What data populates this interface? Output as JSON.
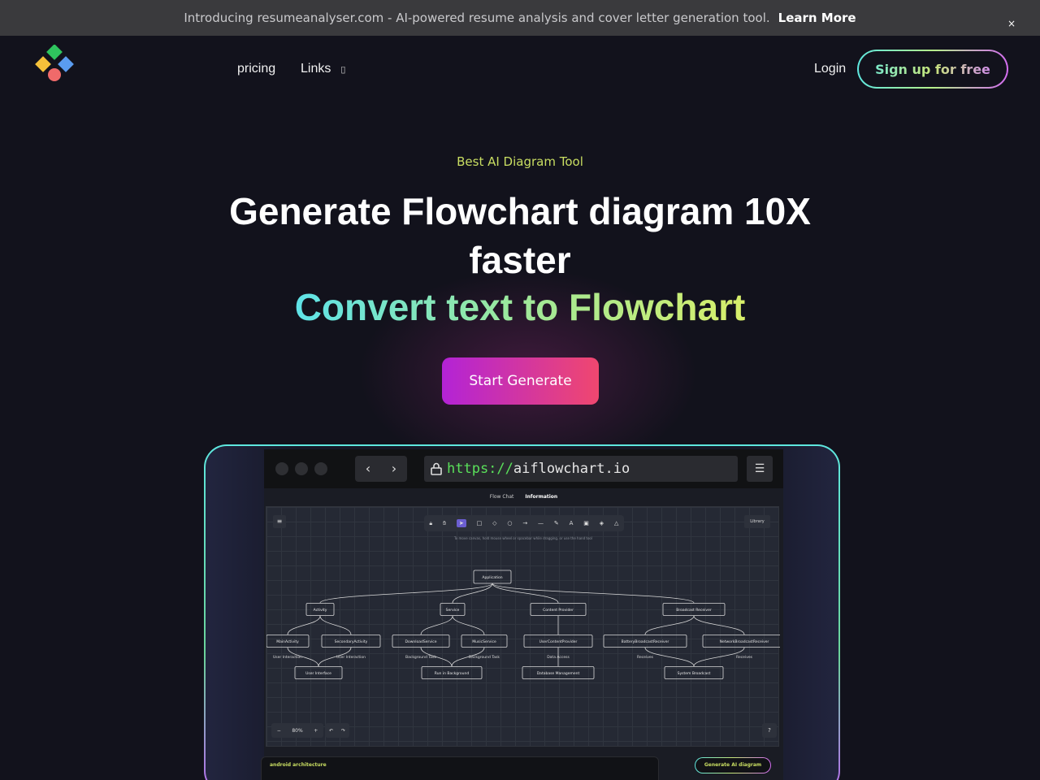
{
  "announcement": {
    "text": "Introducing resumeanalyser.com - AI-powered resume analysis and cover letter generation tool.",
    "link": "Learn More",
    "close": "×"
  },
  "nav": {
    "pricing": "pricing",
    "links": "Links",
    "links_icon": "chevron-down-icon",
    "login": "Login",
    "signup": "Sign up for free"
  },
  "hero": {
    "badge": "Best AI Diagram Tool",
    "headline": "Generate Flowchart diagram 10X faster",
    "subhead": "Convert text to Flowchart",
    "cta": "Start Generate"
  },
  "mockup": {
    "url_protocol": "https://",
    "url_host": "aiflowchart.io",
    "tabs": [
      "Flow Chat",
      "Information"
    ],
    "hint": "To move canvas, hold mouse wheel or spacebar while dragging, or use the hand tool",
    "library": "Library",
    "zoom": "80%",
    "prompt": "android architecture",
    "generate_button": "Generate AI diagram",
    "flow": {
      "root": "Application",
      "level1": [
        "Activity",
        "Service",
        "Content Provider",
        "Broadcast Receiver"
      ],
      "level2": [
        "MainActivity",
        "SecondaryActivity",
        "DownloadService",
        "MusicService",
        "UserContentProvider",
        "BatteryBroadcastReceiver",
        "NetworkBroadcastReceiver"
      ],
      "edge_labels": [
        "User Interaction",
        "User Interaction",
        "Background Task",
        "Background Task",
        "Data Access",
        "Receives",
        "Receives"
      ],
      "level3": [
        "User Interface",
        "Run in Background",
        "Database Management",
        "System Broadcast"
      ]
    }
  }
}
